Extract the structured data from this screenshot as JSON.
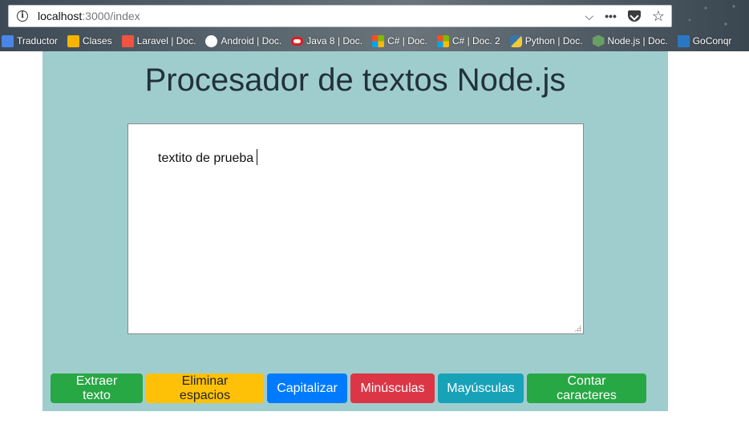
{
  "browser": {
    "url_host": "localhost",
    "url_path": ":3000/index",
    "menu_glyph": "•••",
    "dropdown_glyph": "⌵",
    "star_glyph": "☆",
    "info_glyph": "i",
    "bookmarks": [
      {
        "label": "Traductor",
        "icon": "google-translate-icon",
        "color": "#4a86e8"
      },
      {
        "label": "Clases",
        "icon": "google-classroom-icon",
        "color": "#f6b400"
      },
      {
        "label": "Laravel | Doc.",
        "icon": "laravel-icon",
        "color": "#f05340"
      },
      {
        "label": "Android | Doc.",
        "icon": "google-icon",
        "color": "#ffffff"
      },
      {
        "label": "Java 8 | Doc.",
        "icon": "oracle-icon",
        "color": "#e11b22"
      },
      {
        "label": "C# | Doc.",
        "icon": "microsoft-icon",
        "color": "#7fba00"
      },
      {
        "label": "C# | Doc. 2",
        "icon": "microsoft-icon",
        "color": "#f25022"
      },
      {
        "label": "Python | Doc.",
        "icon": "python-icon",
        "color": "#f7c934"
      },
      {
        "label": "Node.js | Doc.",
        "icon": "nodejs-icon",
        "color": "#68a063"
      },
      {
        "label": "GoConqr",
        "icon": "goconqr-icon",
        "color": "#2b78c2"
      }
    ]
  },
  "page": {
    "title": "Procesador de textos Node.js",
    "background": "#9fcdce",
    "editor_text": "textito de prueba"
  },
  "buttons": [
    {
      "label": "Extraer texto",
      "bg": "#28a745",
      "fg": "#ffffff"
    },
    {
      "label": "Eliminar espacios",
      "bg": "#ffc107",
      "fg": "#212529"
    },
    {
      "label": "Capitalizar",
      "bg": "#007bff",
      "fg": "#ffffff"
    },
    {
      "label": "Minúsculas",
      "bg": "#dc3545",
      "fg": "#ffffff"
    },
    {
      "label": "Mayúsculas",
      "bg": "#17a2b8",
      "fg": "#ffffff"
    },
    {
      "label": "Contar caracteres",
      "bg": "#28a745",
      "fg": "#ffffff"
    }
  ]
}
